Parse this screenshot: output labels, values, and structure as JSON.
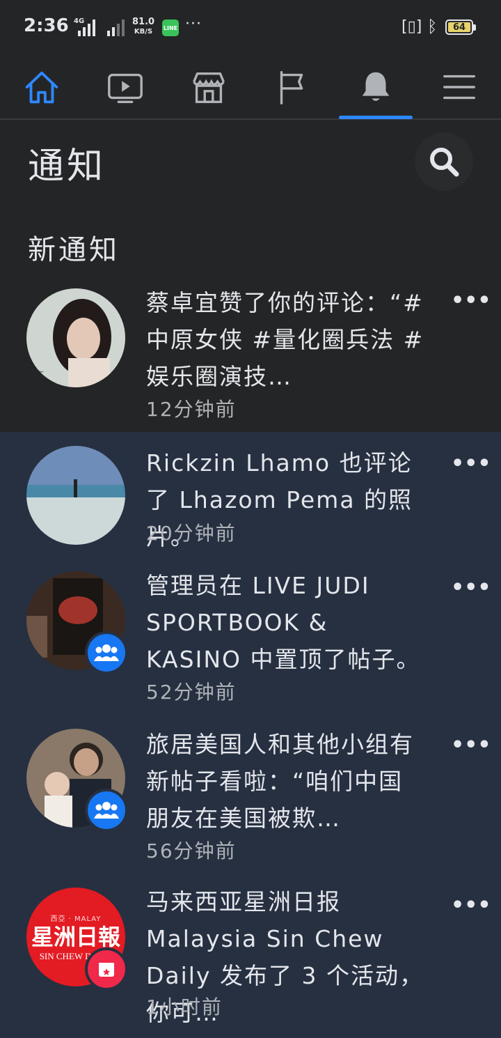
{
  "status_bar": {
    "time": "2:36",
    "network_label": "4G",
    "speed_value": "81.0",
    "speed_unit": "KB/S",
    "line_app": "LINE",
    "more": "···",
    "battery": "64"
  },
  "tabs": [
    {
      "name": "home",
      "icon": "home-icon",
      "active": false
    },
    {
      "name": "watch",
      "icon": "video-icon",
      "active": false
    },
    {
      "name": "marketplace",
      "icon": "store-icon",
      "active": false
    },
    {
      "name": "pages",
      "icon": "flag-icon",
      "active": false
    },
    {
      "name": "notifications",
      "icon": "bell-icon",
      "active": true
    },
    {
      "name": "menu",
      "icon": "menu-icon",
      "active": false
    }
  ],
  "header": {
    "title": "通知"
  },
  "section": {
    "title": "新通知"
  },
  "notifications": [
    {
      "text": "蔡卓宜赞了你的评论：“#中原女侠 #量化圈兵法 #娱乐圈演技…",
      "time": "12分钟前",
      "unread": false,
      "badge": "none"
    },
    {
      "text": "Rickzin Lhamo 也评论了 Lhazom Pema 的照片。",
      "time": "20分钟前",
      "unread": true,
      "badge": "none"
    },
    {
      "text": "管理员在 LIVE JUDI SPORTBOOK & KASINO 中置顶了帖子。",
      "time": "52分钟前",
      "unread": true,
      "badge": "group-icon"
    },
    {
      "text": "旅居美国人和其他小组有新帖子看啦：“咱们中国朋友在美国被欺…",
      "time": "56分钟前",
      "unread": true,
      "badge": "group-icon"
    },
    {
      "text": "马来西亚星洲日报 Malaysia Sin Chew Daily 发布了 3 个活动，你可…",
      "time": "1小时前",
      "unread": true,
      "badge": "event-icon"
    }
  ],
  "avatars": {
    "sin_chew_top": "西亞 · MALAY",
    "sin_chew_main": "星洲日報",
    "sin_chew_sub": "SIN CHEW DAILY"
  },
  "colors": {
    "background": "#242526",
    "unread_background": "#263041",
    "accent": "#2d88ff",
    "badge_blue": "#1877f2",
    "badge_red": "#f02849"
  }
}
